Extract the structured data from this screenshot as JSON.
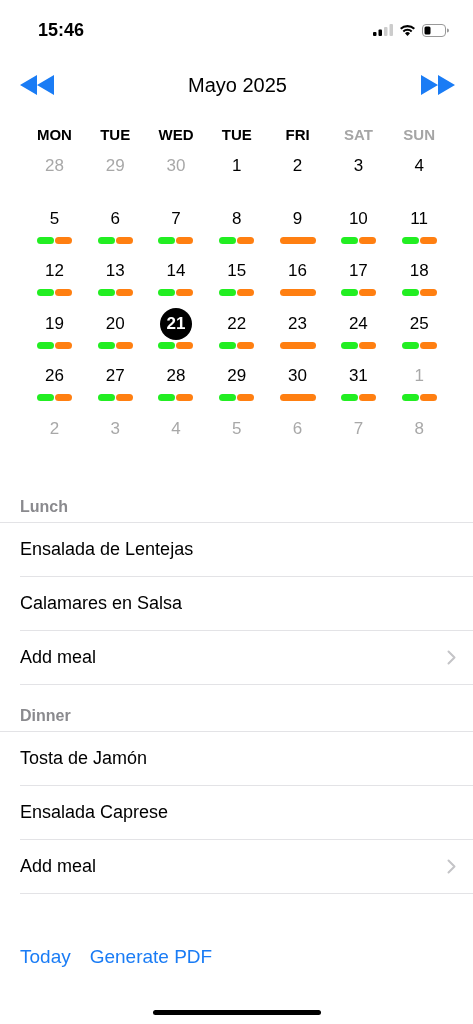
{
  "status_bar": {
    "time": "15:46"
  },
  "calendar": {
    "title": "Mayo 2025",
    "weekdays": [
      {
        "label": "MON",
        "weekend": false
      },
      {
        "label": "TUE",
        "weekend": false
      },
      {
        "label": "WED",
        "weekend": false
      },
      {
        "label": "TUE",
        "weekend": false
      },
      {
        "label": "FRI",
        "weekend": false
      },
      {
        "label": "SAT",
        "weekend": true
      },
      {
        "label": "SUN",
        "weekend": true
      }
    ],
    "weeks": [
      [
        {
          "label": "28",
          "in_month": false,
          "selected": false
        },
        {
          "label": "29",
          "in_month": false,
          "selected": false
        },
        {
          "label": "30",
          "in_month": false,
          "selected": false
        },
        {
          "label": "1",
          "in_month": true,
          "selected": false
        },
        {
          "label": "2",
          "in_month": true,
          "selected": false
        },
        {
          "label": "3",
          "in_month": true,
          "selected": false
        },
        {
          "label": "4",
          "in_month": true,
          "selected": false
        }
      ],
      [
        {
          "label": "5",
          "in_month": true,
          "selected": false,
          "bars": [
            {
              "color": "#22ee22"
            },
            {
              "color": "#ff7f11"
            }
          ]
        },
        {
          "label": "6",
          "in_month": true,
          "selected": false,
          "bars": [
            {
              "color": "#22ee22"
            },
            {
              "color": "#ff7f11"
            }
          ]
        },
        {
          "label": "7",
          "in_month": true,
          "selected": false,
          "bars": [
            {
              "color": "#22ee22"
            },
            {
              "color": "#ff7f11"
            }
          ]
        },
        {
          "label": "8",
          "in_month": true,
          "selected": false,
          "bars": [
            {
              "color": "#22ee22"
            },
            {
              "color": "#ff7f11"
            }
          ]
        },
        {
          "label": "9",
          "in_month": true,
          "selected": false,
          "bars": [
            {
              "color": "#ff7f11"
            }
          ]
        },
        {
          "label": "10",
          "in_month": true,
          "selected": false,
          "bars": [
            {
              "color": "#22ee22"
            },
            {
              "color": "#ff7f11"
            }
          ]
        },
        {
          "label": "11",
          "in_month": true,
          "selected": false,
          "bars": [
            {
              "color": "#22ee22"
            },
            {
              "color": "#ff7f11"
            }
          ]
        }
      ],
      [
        {
          "label": "12",
          "in_month": true,
          "selected": false,
          "bars": [
            {
              "color": "#22ee22"
            },
            {
              "color": "#ff7f11"
            }
          ]
        },
        {
          "label": "13",
          "in_month": true,
          "selected": false,
          "bars": [
            {
              "color": "#22ee22"
            },
            {
              "color": "#ff7f11"
            }
          ]
        },
        {
          "label": "14",
          "in_month": true,
          "selected": false,
          "bars": [
            {
              "color": "#22ee22"
            },
            {
              "color": "#ff7f11"
            }
          ]
        },
        {
          "label": "15",
          "in_month": true,
          "selected": false,
          "bars": [
            {
              "color": "#22ee22"
            },
            {
              "color": "#ff7f11"
            }
          ]
        },
        {
          "label": "16",
          "in_month": true,
          "selected": false,
          "bars": [
            {
              "color": "#ff7f11"
            }
          ]
        },
        {
          "label": "17",
          "in_month": true,
          "selected": false,
          "bars": [
            {
              "color": "#22ee22"
            },
            {
              "color": "#ff7f11"
            }
          ]
        },
        {
          "label": "18",
          "in_month": true,
          "selected": false,
          "bars": [
            {
              "color": "#22ee22"
            },
            {
              "color": "#ff7f11"
            }
          ]
        }
      ],
      [
        {
          "label": "19",
          "in_month": true,
          "selected": false,
          "bars": [
            {
              "color": "#22ee22"
            },
            {
              "color": "#ff7f11"
            }
          ]
        },
        {
          "label": "20",
          "in_month": true,
          "selected": false,
          "bars": [
            {
              "color": "#22ee22"
            },
            {
              "color": "#ff7f11"
            }
          ]
        },
        {
          "label": "21",
          "in_month": true,
          "selected": true,
          "bars": [
            {
              "color": "#22ee22"
            },
            {
              "color": "#ff7f11"
            }
          ]
        },
        {
          "label": "22",
          "in_month": true,
          "selected": false,
          "bars": [
            {
              "color": "#22ee22"
            },
            {
              "color": "#ff7f11"
            }
          ]
        },
        {
          "label": "23",
          "in_month": true,
          "selected": false,
          "bars": [
            {
              "color": "#ff7f11"
            }
          ]
        },
        {
          "label": "24",
          "in_month": true,
          "selected": false,
          "bars": [
            {
              "color": "#22ee22"
            },
            {
              "color": "#ff7f11"
            }
          ]
        },
        {
          "label": "25",
          "in_month": true,
          "selected": false,
          "bars": [
            {
              "color": "#22ee22"
            },
            {
              "color": "#ff7f11"
            }
          ]
        }
      ],
      [
        {
          "label": "26",
          "in_month": true,
          "selected": false,
          "bars": [
            {
              "color": "#22ee22"
            },
            {
              "color": "#ff7f11"
            }
          ]
        },
        {
          "label": "27",
          "in_month": true,
          "selected": false,
          "bars": [
            {
              "color": "#22ee22"
            },
            {
              "color": "#ff7f11"
            }
          ]
        },
        {
          "label": "28",
          "in_month": true,
          "selected": false,
          "bars": [
            {
              "color": "#22ee22"
            },
            {
              "color": "#ff7f11"
            }
          ]
        },
        {
          "label": "29",
          "in_month": true,
          "selected": false,
          "bars": [
            {
              "color": "#22ee22"
            },
            {
              "color": "#ff7f11"
            }
          ]
        },
        {
          "label": "30",
          "in_month": true,
          "selected": false,
          "bars": [
            {
              "color": "#ff7f11"
            }
          ]
        },
        {
          "label": "31",
          "in_month": true,
          "selected": false,
          "bars": [
            {
              "color": "#22ee22"
            },
            {
              "color": "#ff7f11"
            }
          ]
        },
        {
          "label": "1",
          "in_month": false,
          "selected": false,
          "bars": [
            {
              "color": "#22ee22"
            },
            {
              "color": "#ff7f11"
            }
          ]
        }
      ],
      [
        {
          "label": "2",
          "in_month": false,
          "selected": false
        },
        {
          "label": "3",
          "in_month": false,
          "selected": false
        },
        {
          "label": "4",
          "in_month": false,
          "selected": false
        },
        {
          "label": "5",
          "in_month": false,
          "selected": false
        },
        {
          "label": "6",
          "in_month": false,
          "selected": false
        },
        {
          "label": "7",
          "in_month": false,
          "selected": false
        },
        {
          "label": "8",
          "in_month": false,
          "selected": false
        }
      ]
    ]
  },
  "sections": [
    {
      "title": "Lunch",
      "rows": [
        {
          "label": "Ensalada de Lentejas",
          "kind": "meal"
        },
        {
          "label": "Calamares en Salsa",
          "kind": "meal"
        },
        {
          "label": "Add meal",
          "kind": "add"
        }
      ]
    },
    {
      "title": "Dinner",
      "rows": [
        {
          "label": "Tosta de Jamón",
          "kind": "meal"
        },
        {
          "label": "Ensalada Caprese",
          "kind": "meal"
        },
        {
          "label": "Add meal",
          "kind": "add"
        }
      ]
    }
  ],
  "footer_links": [
    "Today",
    "Generate PDF"
  ]
}
